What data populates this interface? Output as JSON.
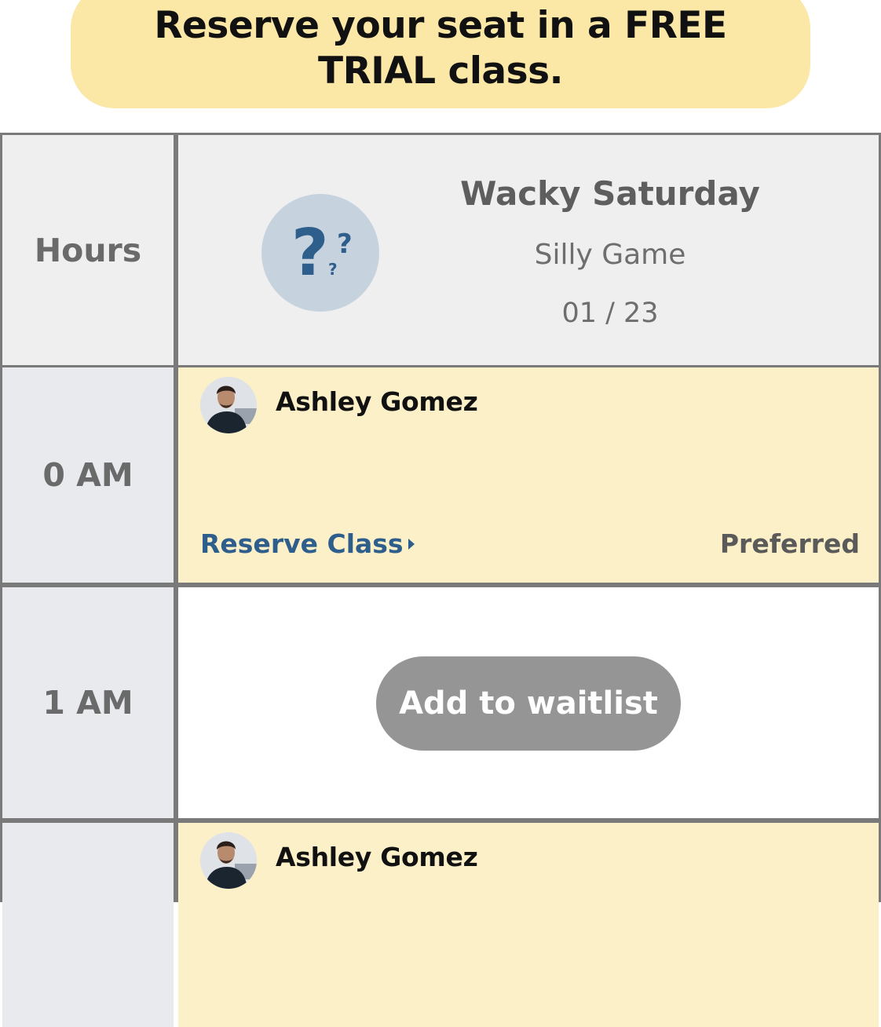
{
  "banner": {
    "text": "Reserve your seat in a FREE TRIAL class."
  },
  "header": {
    "hours_label": "Hours",
    "class_title": "Wacky Saturday",
    "class_subtitle": "Silly Game",
    "class_date": "01 / 23",
    "icon": "question-marks-icon"
  },
  "slots": [
    {
      "hour": "0 AM",
      "teacher": "Ashley Gomez",
      "reserve_label": "Reserve Class",
      "tag": "Preferred"
    },
    {
      "hour": "1 AM",
      "button_label": "Add to waitlist"
    },
    {
      "hour": "",
      "teacher": "Ashley Gomez"
    }
  ],
  "colors": {
    "banner": "#fbe7a6",
    "slot_highlight": "#fcf0c9",
    "link": "#2e5e8c",
    "waitlist_button": "#959595",
    "grid_lines": "#7a7a7a"
  }
}
